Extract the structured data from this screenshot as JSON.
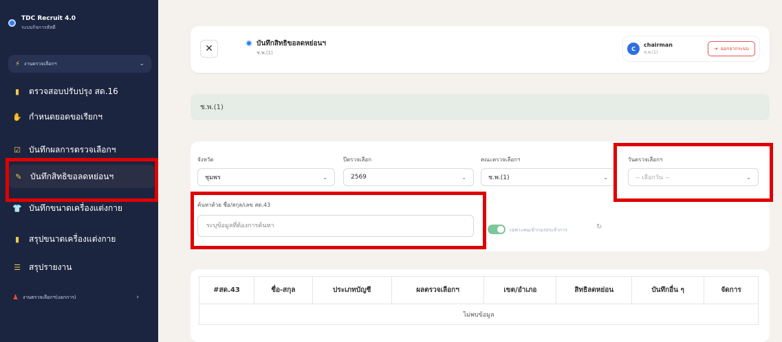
{
  "sidebar": {
    "brand_title": "TDC Recruit 4.0",
    "brand_subtitle": "ระบบกิจการสัสดี",
    "group_label": "งานตรวจเลือกฯ",
    "items": [
      {
        "label": "ตรวจสอบปรับปรุง สด.16",
        "icon": "file-icon"
      },
      {
        "label": "กำหนดยอดขอเรียกฯ",
        "icon": "hand-icon"
      },
      {
        "label": "บันทึกผลการตรวจเลือกฯ",
        "icon": "check-icon"
      },
      {
        "label": "บันทึกสิทธิขอลดหย่อนฯ",
        "icon": "edit-icon"
      },
      {
        "label": "บันทึกขนาดเครื่องแต่งกาย",
        "icon": "shirt-icon"
      },
      {
        "label": "สรุปขนาดเครื่องแต่งกาย",
        "icon": "file-icon"
      },
      {
        "label": "สรุปรายงาน",
        "icon": "chart-icon"
      }
    ],
    "bottom_group_label": "งานตรวจเลือกฯ(แยกการ)"
  },
  "header": {
    "title": "บันทึกสิทธิขอลดหย่อนฯ",
    "subtitle": "ช.พ.(1)",
    "user_name": "chairman",
    "user_role": "ช.พ.(1)",
    "avatar_letter": "C",
    "logout_label": "ออกจากระบบ"
  },
  "band_label": "ช.พ.(1)",
  "filters": {
    "province_label": "จังหวัด",
    "province_value": "ชุมพร",
    "year_label": "ปีตรวจเลือก",
    "year_value": "2569",
    "committee_label": "คณะตรวจเลือกฯ",
    "committee_value": "ช.พ.(1)",
    "date_label": "วันตรวจเลือกฯ",
    "date_value": "-- เลือกวัน --",
    "search_label": "ค้นหาด้วย ชื่อ/สกุล/เลข สด.43",
    "search_placeholder": "ระบุข้อมูลที่ต้องการค้นหา",
    "toggle_label": "เฉพาะคนเข้ากองประจำการ"
  },
  "table": {
    "headers": [
      "#สด.43",
      "ชื่อ-สกุล",
      "ประเภทบัญชี",
      "ผลตรวจเลือกฯ",
      "เขต/อำเภอ",
      "สิทธิลดหย่อน",
      "บันทึกอื่น ๆ",
      "จัดการ"
    ],
    "empty_text": "ไม่พบข้อมูล"
  },
  "colors": {
    "sidebar_bg": "#1c2540",
    "accent": "#2f80ed",
    "highlight_frame": "#e00000"
  }
}
